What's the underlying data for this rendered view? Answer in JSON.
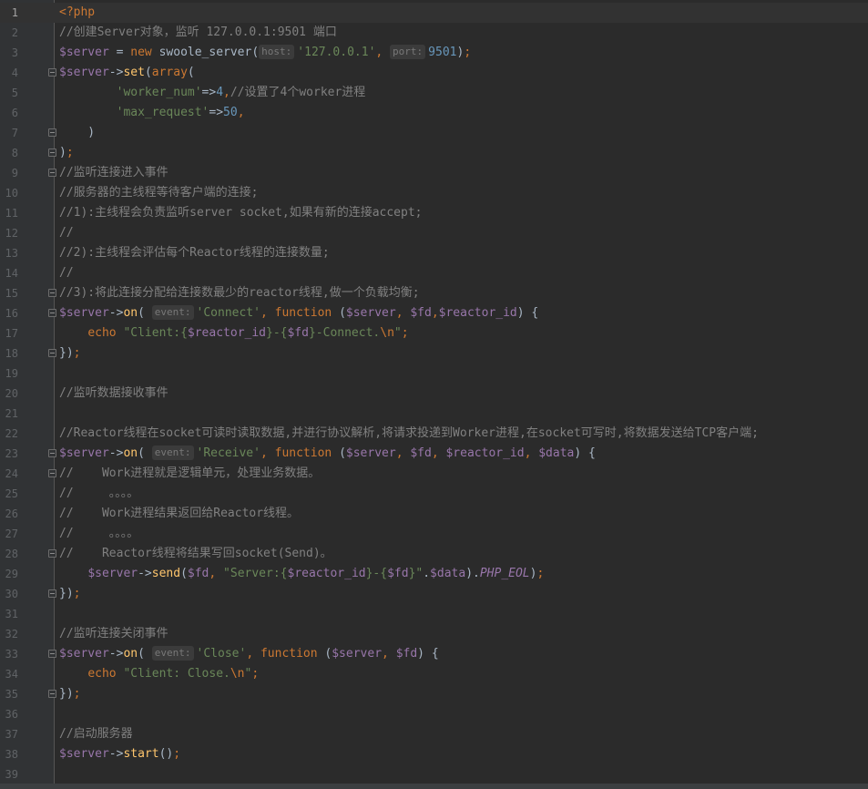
{
  "editor": {
    "language": "php",
    "current_line": 1,
    "lines": [
      {
        "n": "1",
        "fold": false,
        "tokens": [
          {
            "c": "kw",
            "t": "<?php"
          }
        ]
      },
      {
        "n": "2",
        "fold": false,
        "tokens": [
          {
            "c": "com",
            "t": "//创建Server对象，监听 127.0.0.1:9501 端口"
          }
        ]
      },
      {
        "n": "3",
        "fold": false,
        "tokens": [
          {
            "c": "var",
            "t": "$server"
          },
          {
            "c": "",
            "t": " = "
          },
          {
            "c": "kw",
            "t": "new "
          },
          {
            "c": "",
            "t": "swoole_server("
          },
          {
            "c": "hint",
            "t": "host:"
          },
          {
            "c": "str",
            "t": "'127.0.0.1'"
          },
          {
            "c": "kw",
            "t": ", "
          },
          {
            "c": "hint",
            "t": "port:"
          },
          {
            "c": "num",
            "t": "9501"
          },
          {
            "c": "",
            "t": ")"
          },
          {
            "c": "kw",
            "t": ";"
          }
        ]
      },
      {
        "n": "4",
        "fold": true,
        "tokens": [
          {
            "c": "var",
            "t": "$server"
          },
          {
            "c": "",
            "t": "->"
          },
          {
            "c": "fn",
            "t": "set"
          },
          {
            "c": "",
            "t": "("
          },
          {
            "c": "kw",
            "t": "array"
          },
          {
            "c": "",
            "t": "("
          }
        ]
      },
      {
        "n": "5",
        "fold": false,
        "tokens": [
          {
            "c": "",
            "t": "        "
          },
          {
            "c": "str",
            "t": "'worker_num'"
          },
          {
            "c": "",
            "t": "=>"
          },
          {
            "c": "num",
            "t": "4"
          },
          {
            "c": "kw",
            "t": ","
          },
          {
            "c": "com",
            "t": "//设置了4个worker进程"
          }
        ]
      },
      {
        "n": "6",
        "fold": false,
        "tokens": [
          {
            "c": "",
            "t": "        "
          },
          {
            "c": "str",
            "t": "'max_request'"
          },
          {
            "c": "",
            "t": "=>"
          },
          {
            "c": "num",
            "t": "50"
          },
          {
            "c": "kw",
            "t": ","
          }
        ]
      },
      {
        "n": "7",
        "fold": true,
        "tokens": [
          {
            "c": "",
            "t": "    )"
          }
        ]
      },
      {
        "n": "8",
        "fold": true,
        "tokens": [
          {
            "c": "",
            "t": ")"
          },
          {
            "c": "kw",
            "t": ";"
          }
        ]
      },
      {
        "n": "9",
        "fold": true,
        "tokens": [
          {
            "c": "com",
            "t": "//监听连接进入事件"
          }
        ]
      },
      {
        "n": "10",
        "fold": false,
        "tokens": [
          {
            "c": "com",
            "t": "//服务器的主线程等待客户端的连接;"
          }
        ]
      },
      {
        "n": "11",
        "fold": false,
        "tokens": [
          {
            "c": "com",
            "t": "//1):主线程会负责监听server socket,如果有新的连接accept;"
          }
        ]
      },
      {
        "n": "12",
        "fold": false,
        "tokens": [
          {
            "c": "com",
            "t": "//"
          }
        ]
      },
      {
        "n": "13",
        "fold": false,
        "tokens": [
          {
            "c": "com",
            "t": "//2):主线程会评估每个Reactor线程的连接数量;"
          }
        ]
      },
      {
        "n": "14",
        "fold": false,
        "tokens": [
          {
            "c": "com",
            "t": "//"
          }
        ]
      },
      {
        "n": "15",
        "fold": true,
        "tokens": [
          {
            "c": "com",
            "t": "//3):将此连接分配给连接数最少的reactor线程,做一个负载均衡;"
          }
        ]
      },
      {
        "n": "16",
        "fold": true,
        "tokens": [
          {
            "c": "var",
            "t": "$server"
          },
          {
            "c": "",
            "t": "->"
          },
          {
            "c": "fn",
            "t": "on"
          },
          {
            "c": "",
            "t": "( "
          },
          {
            "c": "hint",
            "t": "event:"
          },
          {
            "c": "str",
            "t": "'Connect'"
          },
          {
            "c": "kw",
            "t": ", function "
          },
          {
            "c": "",
            "t": "("
          },
          {
            "c": "var",
            "t": "$server"
          },
          {
            "c": "kw",
            "t": ", "
          },
          {
            "c": "var",
            "t": "$fd"
          },
          {
            "c": "kw",
            "t": ","
          },
          {
            "c": "var",
            "t": "$reactor_id"
          },
          {
            "c": "",
            "t": ") {"
          }
        ]
      },
      {
        "n": "17",
        "fold": false,
        "tokens": [
          {
            "c": "",
            "t": "    "
          },
          {
            "c": "kw",
            "t": "echo "
          },
          {
            "c": "str",
            "t": "\"Client:{"
          },
          {
            "c": "var",
            "t": "$reactor_id"
          },
          {
            "c": "str",
            "t": "}-{"
          },
          {
            "c": "var",
            "t": "$fd"
          },
          {
            "c": "str",
            "t": "}-Connect."
          },
          {
            "c": "esc",
            "t": "\\n"
          },
          {
            "c": "str",
            "t": "\""
          },
          {
            "c": "kw",
            "t": ";"
          }
        ]
      },
      {
        "n": "18",
        "fold": true,
        "tokens": [
          {
            "c": "",
            "t": "})"
          },
          {
            "c": "kw",
            "t": ";"
          }
        ]
      },
      {
        "n": "19",
        "fold": false,
        "tokens": []
      },
      {
        "n": "20",
        "fold": false,
        "tokens": [
          {
            "c": "com",
            "t": "//监听数据接收事件"
          }
        ]
      },
      {
        "n": "21",
        "fold": false,
        "tokens": []
      },
      {
        "n": "22",
        "fold": false,
        "tokens": [
          {
            "c": "com",
            "t": "//Reactor线程在socket可读时读取数据,并进行协议解析,将请求投递到Worker进程,在socket可写时,将数据发送给TCP客户端;"
          }
        ]
      },
      {
        "n": "23",
        "fold": true,
        "tokens": [
          {
            "c": "var",
            "t": "$server"
          },
          {
            "c": "",
            "t": "->"
          },
          {
            "c": "fn",
            "t": "on"
          },
          {
            "c": "",
            "t": "( "
          },
          {
            "c": "hint",
            "t": "event:"
          },
          {
            "c": "str",
            "t": "'Receive'"
          },
          {
            "c": "kw",
            "t": ", function "
          },
          {
            "c": "",
            "t": "("
          },
          {
            "c": "var",
            "t": "$server"
          },
          {
            "c": "kw",
            "t": ", "
          },
          {
            "c": "var",
            "t": "$fd"
          },
          {
            "c": "kw",
            "t": ", "
          },
          {
            "c": "var",
            "t": "$reactor_id"
          },
          {
            "c": "kw",
            "t": ", "
          },
          {
            "c": "var",
            "t": "$data"
          },
          {
            "c": "",
            "t": ") {"
          }
        ]
      },
      {
        "n": "24",
        "fold": true,
        "tokens": [
          {
            "c": "com",
            "t": "//    Work进程就是逻辑单元，处理业务数据。"
          }
        ]
      },
      {
        "n": "25",
        "fold": false,
        "tokens": [
          {
            "c": "com",
            "t": "//     。。。。"
          }
        ]
      },
      {
        "n": "26",
        "fold": false,
        "tokens": [
          {
            "c": "com",
            "t": "//    Work进程结果返回给Reactor线程。"
          }
        ]
      },
      {
        "n": "27",
        "fold": false,
        "tokens": [
          {
            "c": "com",
            "t": "//     。。。。"
          }
        ]
      },
      {
        "n": "28",
        "fold": true,
        "tokens": [
          {
            "c": "com",
            "t": "//    Reactor线程将结果写回socket(Send)。"
          }
        ]
      },
      {
        "n": "29",
        "fold": false,
        "tokens": [
          {
            "c": "",
            "t": "    "
          },
          {
            "c": "var",
            "t": "$server"
          },
          {
            "c": "",
            "t": "->"
          },
          {
            "c": "fn",
            "t": "send"
          },
          {
            "c": "",
            "t": "("
          },
          {
            "c": "var",
            "t": "$fd"
          },
          {
            "c": "kw",
            "t": ", "
          },
          {
            "c": "str",
            "t": "\"Server:{"
          },
          {
            "c": "var",
            "t": "$reactor_id"
          },
          {
            "c": "str",
            "t": "}-{"
          },
          {
            "c": "var",
            "t": "$fd"
          },
          {
            "c": "str",
            "t": "}\""
          },
          {
            "c": "",
            "t": "."
          },
          {
            "c": "var",
            "t": "$data"
          },
          {
            "c": "",
            "t": ")."
          },
          {
            "c": "const",
            "t": "PHP_EOL"
          },
          {
            "c": "",
            "t": ")"
          },
          {
            "c": "kw",
            "t": ";"
          }
        ]
      },
      {
        "n": "30",
        "fold": true,
        "tokens": [
          {
            "c": "",
            "t": "})"
          },
          {
            "c": "kw",
            "t": ";"
          }
        ]
      },
      {
        "n": "31",
        "fold": false,
        "tokens": []
      },
      {
        "n": "32",
        "fold": false,
        "tokens": [
          {
            "c": "com",
            "t": "//监听连接关闭事件"
          }
        ]
      },
      {
        "n": "33",
        "fold": true,
        "tokens": [
          {
            "c": "var",
            "t": "$server"
          },
          {
            "c": "",
            "t": "->"
          },
          {
            "c": "fn",
            "t": "on"
          },
          {
            "c": "",
            "t": "( "
          },
          {
            "c": "hint",
            "t": "event:"
          },
          {
            "c": "str",
            "t": "'Close'"
          },
          {
            "c": "kw",
            "t": ", function "
          },
          {
            "c": "",
            "t": "("
          },
          {
            "c": "var",
            "t": "$server"
          },
          {
            "c": "kw",
            "t": ", "
          },
          {
            "c": "var",
            "t": "$fd"
          },
          {
            "c": "",
            "t": ") {"
          }
        ]
      },
      {
        "n": "34",
        "fold": false,
        "tokens": [
          {
            "c": "",
            "t": "    "
          },
          {
            "c": "kw",
            "t": "echo "
          },
          {
            "c": "str",
            "t": "\"Client: Close."
          },
          {
            "c": "esc",
            "t": "\\n"
          },
          {
            "c": "str",
            "t": "\""
          },
          {
            "c": "kw",
            "t": ";"
          }
        ]
      },
      {
        "n": "35",
        "fold": true,
        "tokens": [
          {
            "c": "",
            "t": "})"
          },
          {
            "c": "kw",
            "t": ";"
          }
        ]
      },
      {
        "n": "36",
        "fold": false,
        "tokens": []
      },
      {
        "n": "37",
        "fold": false,
        "tokens": [
          {
            "c": "com",
            "t": "//启动服务器"
          }
        ]
      },
      {
        "n": "38",
        "fold": false,
        "tokens": [
          {
            "c": "var",
            "t": "$server"
          },
          {
            "c": "",
            "t": "->"
          },
          {
            "c": "fn",
            "t": "start"
          },
          {
            "c": "",
            "t": "()"
          },
          {
            "c": "kw",
            "t": ";"
          }
        ]
      },
      {
        "n": "39",
        "fold": false,
        "tokens": []
      }
    ]
  }
}
